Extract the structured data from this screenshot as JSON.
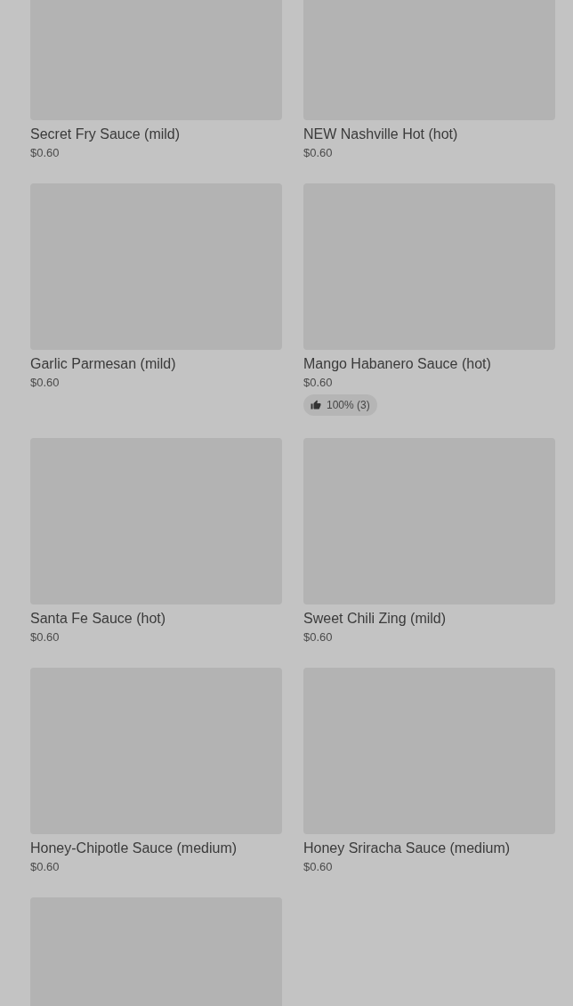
{
  "items": [
    {
      "kind": "picture",
      "name": "Secret Fry Sauce (mild)",
      "price": "$0.60"
    },
    {
      "kind": "picture",
      "name": "NEW Nashville Hot (hot)",
      "price": "$0.60"
    },
    {
      "kind": "picture",
      "name": "Garlic Parmesan (mild)",
      "price": "$0.60"
    },
    {
      "kind": "picture",
      "name": "Mango Habanero Sauce (hot)",
      "price": "$0.60",
      "rating": "100% (3)"
    },
    {
      "kind": "picture",
      "name": "Santa Fe Sauce (hot)",
      "price": "$0.60"
    },
    {
      "kind": "picture",
      "name": "Sweet Chili Zing (mild)",
      "price": "$0.60"
    },
    {
      "kind": "picture",
      "name": "Honey-Chipotle Sauce (medium)",
      "price": "$0.60"
    },
    {
      "kind": "picture",
      "name": "Honey Sriracha Sauce (medium)",
      "price": "$0.60"
    },
    {
      "kind": "picture"
    }
  ]
}
